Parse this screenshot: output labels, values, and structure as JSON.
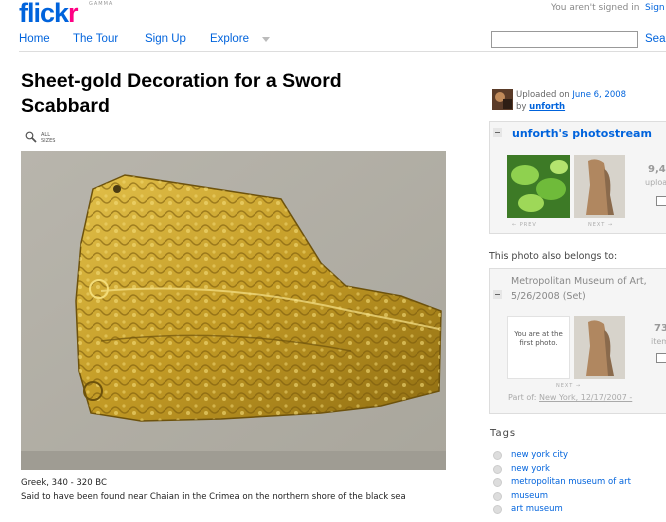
{
  "header": {
    "logo_main": "flick",
    "logo_accent": "r",
    "logo_beta": "GAMMA",
    "signed_in_message": "You aren't signed in",
    "signin_link": "Sign"
  },
  "nav": {
    "items": [
      {
        "label": "Home"
      },
      {
        "label": "The Tour"
      },
      {
        "label": "Sign Up"
      },
      {
        "label": "Explore"
      }
    ],
    "search_value": "",
    "search_button": "Sea"
  },
  "photo": {
    "title": "Sheet-gold Decoration for a Sword Scabbard",
    "all_sizes": "ALL SIZES",
    "caption_line1": "Greek, 340 - 320 BC",
    "caption_line2": "Said to have been found near Chaian in the Crimea on the northern shore of the black sea"
  },
  "sidebar": {
    "uploaded_prefix": "Uploaded on",
    "uploaded_date": "June 6, 2008",
    "by_prefix": "by",
    "by_user": "unforth",
    "stream_title": "unforth's photostream",
    "stream_prev": "← PREV",
    "stream_next": "NEXT →",
    "stream_count": "9,4",
    "stream_count_label": "uploa",
    "belongs_label": "This photo also belongs to:",
    "set_title": "Metropolitan Museum of Art, 5/26/2008 (Set)",
    "set_first_photo": "You are at the first photo.",
    "set_next": "NEXT →",
    "set_count": "73",
    "set_count_label": "item",
    "part_of_label": "Part of:",
    "part_of_link": "New York, 12/17/2007 -"
  },
  "tags": {
    "heading": "Tags",
    "items": [
      {
        "label": "new york city"
      },
      {
        "label": "new york"
      },
      {
        "label": "metropolitan museum of art"
      },
      {
        "label": "museum"
      },
      {
        "label": "art museum"
      }
    ]
  },
  "colors": {
    "link": "#0063dc",
    "brand_pink": "#ff0084",
    "gold": "#c9a227"
  }
}
